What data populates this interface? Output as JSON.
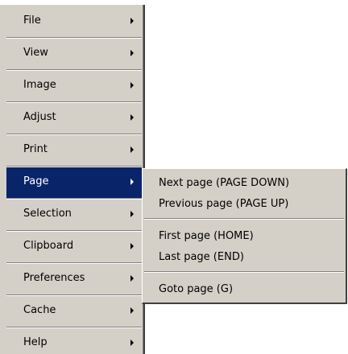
{
  "menu": {
    "items": [
      {
        "label": "File",
        "has_submenu": true,
        "selected": false
      },
      {
        "label": "View",
        "has_submenu": true,
        "selected": false
      },
      {
        "label": "Image",
        "has_submenu": true,
        "selected": false
      },
      {
        "label": "Adjust",
        "has_submenu": true,
        "selected": false
      },
      {
        "label": "Print",
        "has_submenu": true,
        "selected": false
      },
      {
        "label": "Page",
        "has_submenu": true,
        "selected": true
      },
      {
        "label": "Selection",
        "has_submenu": true,
        "selected": false
      },
      {
        "label": "Clipboard",
        "has_submenu": true,
        "selected": false
      },
      {
        "label": "Preferences",
        "has_submenu": true,
        "selected": false
      },
      {
        "label": "Cache",
        "has_submenu": true,
        "selected": false
      },
      {
        "label": "Help",
        "has_submenu": true,
        "selected": false
      }
    ]
  },
  "submenu": {
    "parent": "Page",
    "items": [
      {
        "label": "Next page (PAGE DOWN)"
      },
      {
        "label": "Previous page (PAGE UP)"
      },
      {
        "label": "First page (HOME)"
      },
      {
        "label": "Last page (END)"
      },
      {
        "label": "Goto page (G)"
      }
    ]
  },
  "colors": {
    "menu_background": "#d4d0c8",
    "highlight": "#0a246a",
    "highlight_text": "#ffffff",
    "text": "#000000"
  },
  "icons": {
    "submenu_arrow": "triangle-right-icon"
  }
}
